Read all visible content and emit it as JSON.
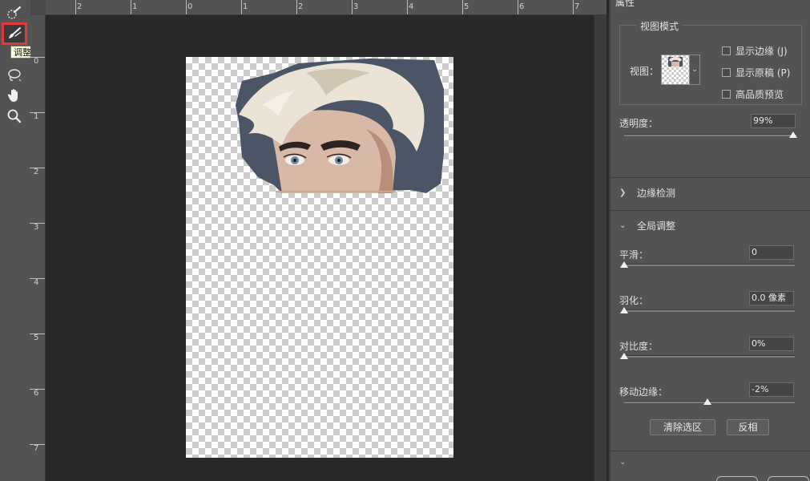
{
  "tooltip": "调整边缘画笔工具 (R)",
  "tools": [
    {
      "name": "quick-selection-icon"
    },
    {
      "name": "refine-edge-brush-icon"
    },
    {
      "name": "lasso-icon"
    },
    {
      "name": "hand-icon"
    },
    {
      "name": "zoom-icon"
    }
  ],
  "ruler_top_labels": [
    "2",
    "1",
    "0",
    "1",
    "2",
    "3",
    "4",
    "5",
    "6",
    "7"
  ],
  "ruler_left_labels": [
    "0",
    "1",
    "2",
    "3",
    "4",
    "5",
    "6",
    "7"
  ],
  "panel": {
    "tab_title": "属性",
    "view_mode": {
      "group_title": "视图模式",
      "view_label": "视图：",
      "show_edge": "显示边缘 (J)",
      "show_original": "显示原稿 (P)",
      "hq_preview": "高品质预览"
    },
    "opacity": {
      "label": "透明度：",
      "value": "99%",
      "level": 0.99
    },
    "edge_detection": {
      "label": "边缘检测"
    },
    "global_refine": {
      "label": "全局调整"
    },
    "smooth": {
      "label": "平滑：",
      "value": "0",
      "level": 0.0
    },
    "feather": {
      "label": "羽化：",
      "value": "0.0 像素",
      "level": 0.0
    },
    "contrast": {
      "label": "对比度：",
      "value": "0%",
      "level": 0.0
    },
    "shift_edge": {
      "label": "移动边缘：",
      "value": "-2%",
      "level": 0.49
    },
    "clear_selection": "清除选区",
    "invert": "反相"
  },
  "colors": {
    "accent_selected": "#e03a3a",
    "panel_bg": "#535353",
    "workspace_bg": "#282828"
  }
}
